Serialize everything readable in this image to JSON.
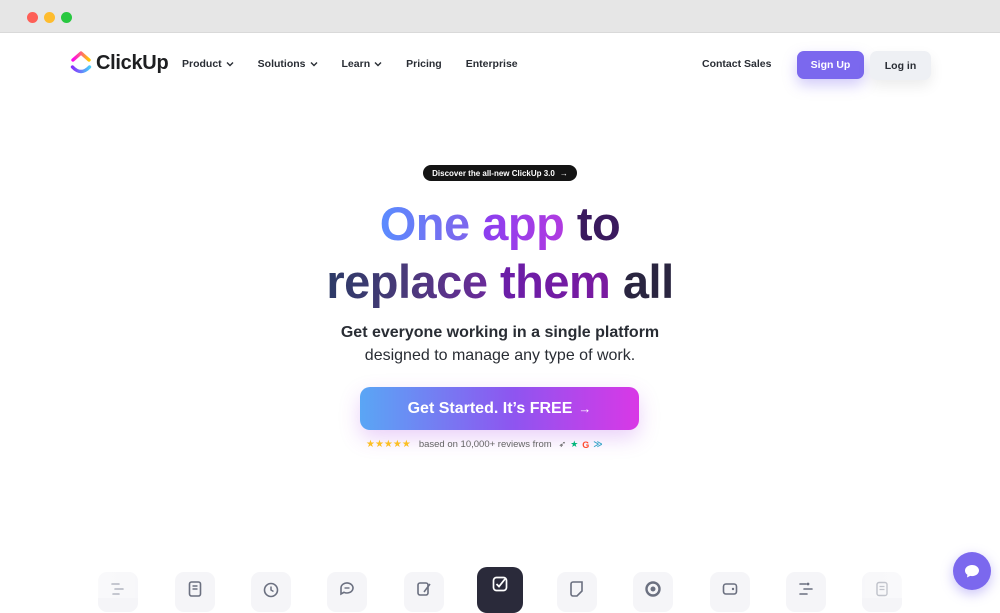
{
  "brand": {
    "name": "ClickUp"
  },
  "nav": {
    "items": [
      {
        "label": "Product",
        "dropdown": true
      },
      {
        "label": "Solutions",
        "dropdown": true
      },
      {
        "label": "Learn",
        "dropdown": true
      },
      {
        "label": "Pricing",
        "dropdown": false
      },
      {
        "label": "Enterprise",
        "dropdown": false
      }
    ],
    "contact_label": "Contact Sales",
    "signup_label": "Sign Up",
    "login_label": "Log in"
  },
  "hero": {
    "announcement": "Discover the all-new ClickUp 3.0",
    "headline_line1": {
      "a": "One",
      "b": "app",
      "c": "to"
    },
    "headline_line2": {
      "a": "replace",
      "b": "them",
      "c": "all"
    },
    "subhead_bold": "Get everyone working in a single platform",
    "subhead": "designed to manage any type of work.",
    "cta_label": "Get Started. It’s FREE",
    "reviews_text": "based on 10,000+ reviews from",
    "stars": "★★★★★"
  },
  "feature_icons": [
    "gantt-icon",
    "doc-icon",
    "clock-icon",
    "chat-icon",
    "whiteboard-icon",
    "task-check-icon",
    "notes-icon",
    "goals-icon",
    "wallet-icon",
    "timeline-icon",
    "page-icon"
  ],
  "colors": {
    "accent": "#7b68ee",
    "text": "#292d34",
    "gradient_start": "#5aa6f5",
    "gradient_end": "#d938e6"
  }
}
